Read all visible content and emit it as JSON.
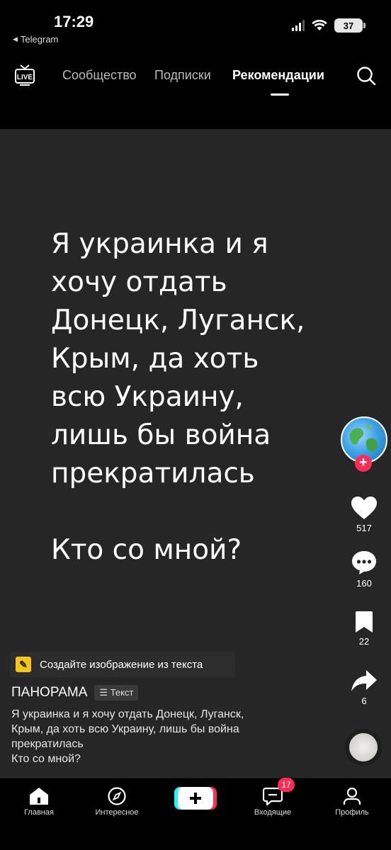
{
  "status_bar": {
    "time": "17:29",
    "back_app": "Telegram",
    "battery": "37"
  },
  "top_nav": {
    "tabs": [
      {
        "label": "Сообщество",
        "active": false
      },
      {
        "label": "Подписки",
        "active": false
      },
      {
        "label": "Рекомендации",
        "active": true
      }
    ],
    "live_icon": "live-tv-icon",
    "search_icon": "search-icon"
  },
  "video": {
    "main_text": "Я украинка и я\nхочу отдать\nДонецк, Луганск,\nКрым, да хоть\nвсю Украину,\nлишь бы война\nпрекратилась\n\nКто со мной?",
    "background_color": "#262626"
  },
  "actions": {
    "likes": "517",
    "comments": "160",
    "saves": "22",
    "shares": "6"
  },
  "post": {
    "create_image_label": "Создайте изображение из текста",
    "author": "ПАНОРАМА",
    "badge": "Текст",
    "caption": "Я украинка и я хочу отдать Донецк, Луганск,\nКрым, да хоть всю Украину, лишь бы война\nпрекратилась\nКто со мной?"
  },
  "tabbar": {
    "items": [
      {
        "label": "Главная",
        "icon": "home-icon"
      },
      {
        "label": "Интересное",
        "icon": "compass-icon"
      },
      {
        "label": "",
        "icon": "create-plus-icon"
      },
      {
        "label": "Входящие",
        "icon": "inbox-icon"
      },
      {
        "label": "Профиль",
        "icon": "profile-icon"
      }
    ],
    "inbox_badge": "17"
  },
  "colors": {
    "accent": "#fe2c55",
    "cyan": "#25f4ee"
  }
}
